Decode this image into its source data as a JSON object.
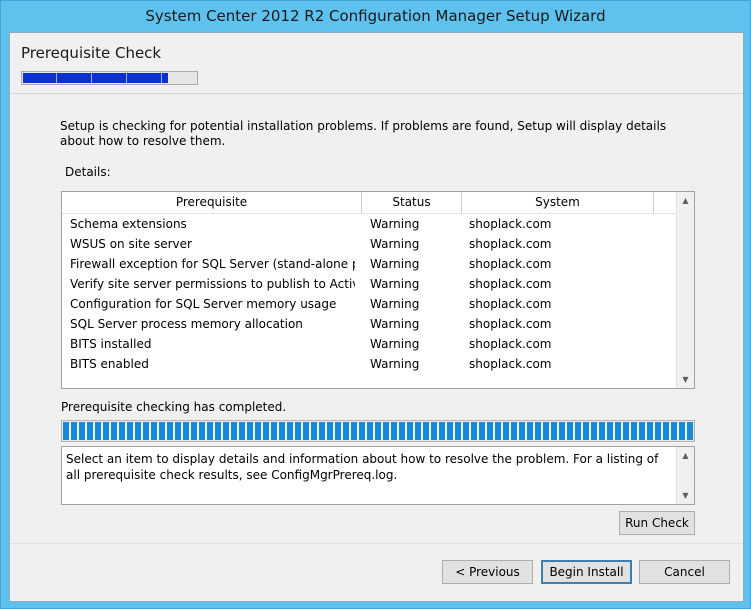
{
  "window": {
    "title": "System Center 2012 R2 Configuration Manager Setup Wizard"
  },
  "header": {
    "title": "Prerequisite Check",
    "step_progress": 0.84
  },
  "intro_text": "Setup is checking for potential installation problems. If problems are found, Setup will display details about how to resolve them.",
  "details_label": "Details:",
  "table": {
    "columns": [
      "Prerequisite",
      "Status",
      "System"
    ],
    "rows": [
      [
        "Schema extensions",
        "Warning",
        "shoplack.com"
      ],
      [
        "WSUS on site server",
        "Warning",
        "shoplack.com"
      ],
      [
        "Firewall exception for SQL Server (stand-alone primary",
        "Warning",
        "shoplack.com"
      ],
      [
        "Verify site server permissions to publish to Active Direc",
        "Warning",
        "shoplack.com"
      ],
      [
        "Configuration for SQL Server memory usage",
        "Warning",
        "shoplack.com"
      ],
      [
        "SQL Server process memory allocation",
        "Warning",
        "shoplack.com"
      ],
      [
        "BITS installed",
        "Warning",
        "shoplack.com"
      ],
      [
        "BITS enabled",
        "Warning",
        "shoplack.com"
      ]
    ]
  },
  "status_text": "Prerequisite checking has completed.",
  "check_progress": 1.0,
  "message": "Select an item to display details and information about how to resolve the problem. For a listing of all prerequisite check results, see ConfigMgrPrereq.log.",
  "buttons": {
    "run_check": "Run Check",
    "previous": "< Previous",
    "begin_install": "Begin Install",
    "cancel": "Cancel"
  },
  "colors": {
    "title_bar": "#5fc2ee",
    "step_fill": "#0c2fd0",
    "progress_fill": "#1a8ad6"
  },
  "icons": {
    "scroll_up": "scroll-up-arrow",
    "scroll_down": "scroll-down-arrow"
  }
}
